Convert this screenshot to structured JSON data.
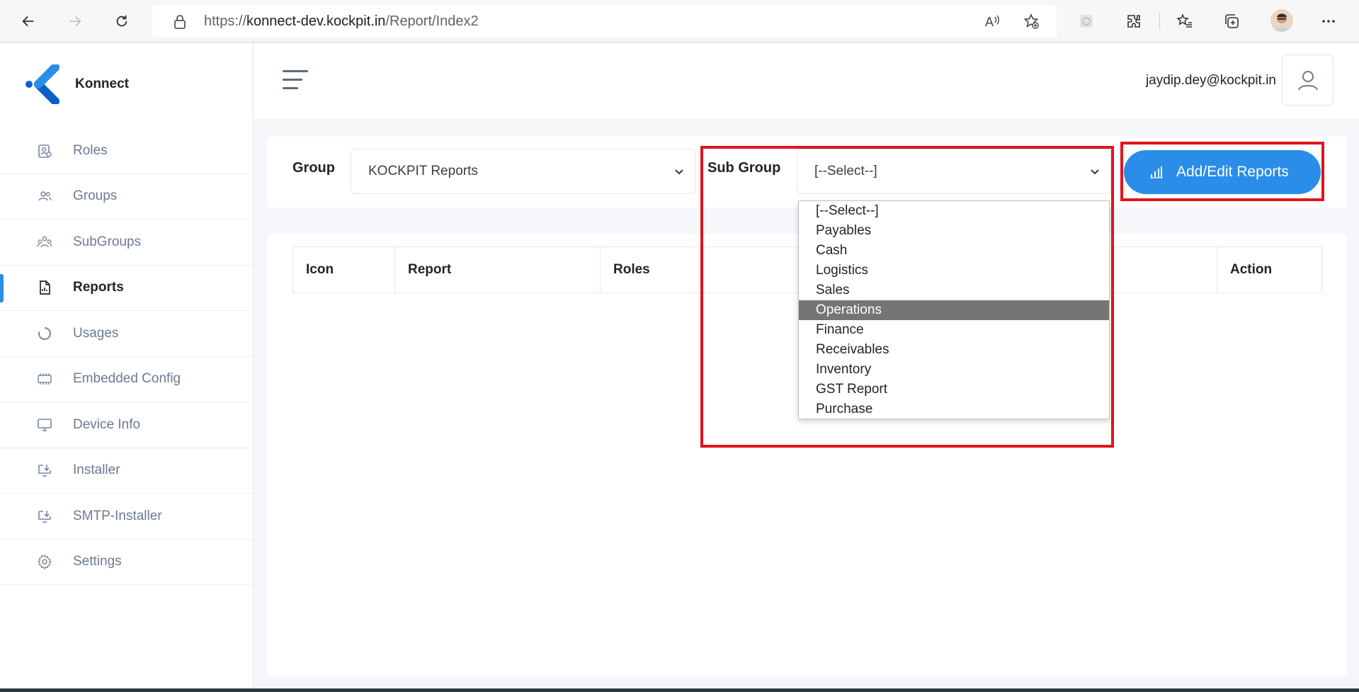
{
  "browser": {
    "url_prefix": "https://",
    "url_host": "konnect-dev.kockpit.in",
    "url_path": "/Report/Index2",
    "icons": [
      "back-icon",
      "forward-icon",
      "refresh-icon",
      "lock-icon",
      "read-aloud-icon",
      "add-favorite-icon",
      "extension-icon",
      "puzzle-icon",
      "favorites-icon",
      "collections-icon",
      "profile-avatar",
      "more-icon"
    ]
  },
  "brand": {
    "name": "Konnect"
  },
  "sidebar": {
    "items": [
      {
        "label": "Roles",
        "icon": "roles-icon"
      },
      {
        "label": "Groups",
        "icon": "groups-icon"
      },
      {
        "label": "SubGroups",
        "icon": "subgroups-icon"
      },
      {
        "label": "Reports",
        "icon": "reports-icon",
        "active": true
      },
      {
        "label": "Usages",
        "icon": "usages-icon"
      },
      {
        "label": "Embedded Config",
        "icon": "embedded-config-icon"
      },
      {
        "label": "Device Info",
        "icon": "device-info-icon"
      },
      {
        "label": "Installer",
        "icon": "installer-icon"
      },
      {
        "label": "SMTP-Installer",
        "icon": "smtp-installer-icon"
      },
      {
        "label": "Settings",
        "icon": "settings-icon"
      }
    ]
  },
  "header": {
    "user_email": "jaydip.dey@kockpit.in"
  },
  "filters": {
    "group_label": "Group",
    "group_value": "KOCKPIT Reports",
    "subgroup_label": "Sub Group",
    "subgroup_value": "[--Select--]",
    "add_button_label": "Add/Edit Reports"
  },
  "table": {
    "columns": [
      "Icon",
      "Report",
      "Roles",
      "",
      "Action"
    ]
  },
  "subgroup_options": {
    "items": [
      "[--Select--]",
      "Payables",
      "Cash",
      "Logistics",
      "Sales",
      "Operations",
      "Finance",
      "Receivables",
      "Inventory",
      "GST Report",
      "Purchase"
    ],
    "highlighted": "Operations"
  },
  "colors": {
    "accent": "#2a8de8",
    "highlight_box": "#e0141e",
    "option_hover": "#757575"
  }
}
